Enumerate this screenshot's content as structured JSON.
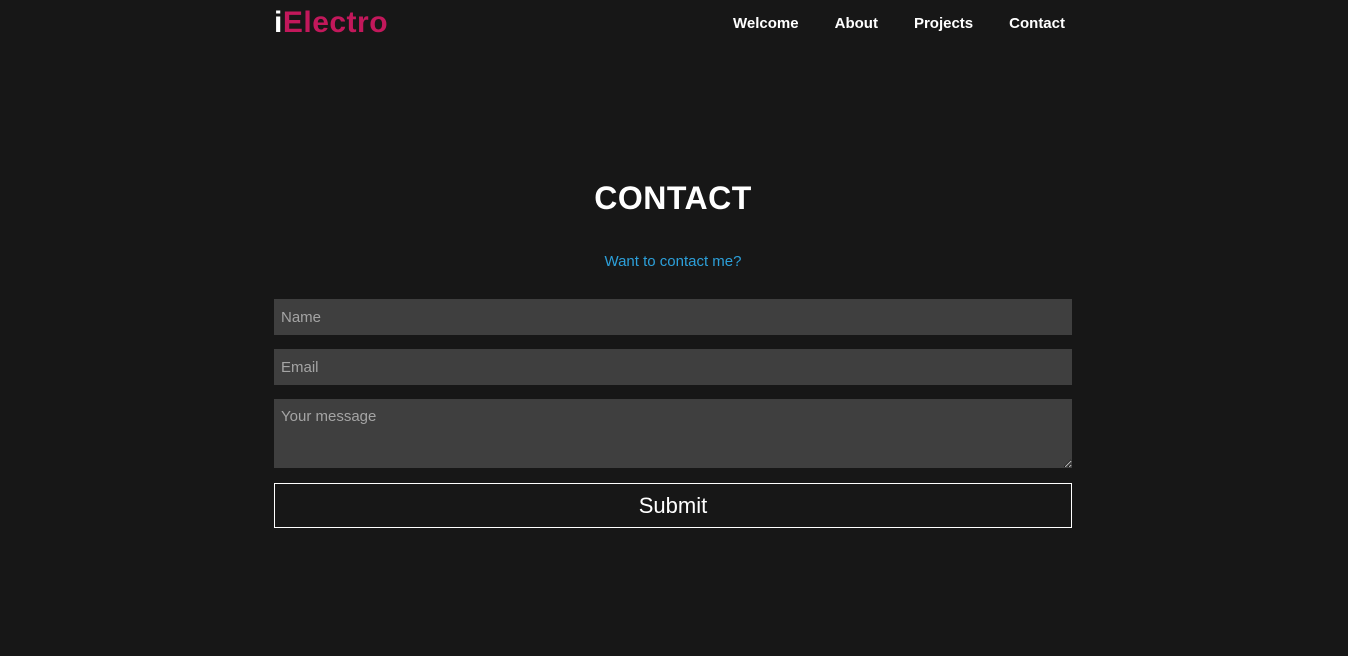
{
  "logo": {
    "prefix": "i",
    "name": "Electro"
  },
  "nav": {
    "items": [
      {
        "label": "Welcome"
      },
      {
        "label": "About"
      },
      {
        "label": "Projects"
      },
      {
        "label": "Contact"
      }
    ]
  },
  "contact": {
    "title": "CONTACT",
    "subtitle": "Want to contact me?",
    "name_placeholder": "Name",
    "email_placeholder": "Email",
    "message_placeholder": "Your message",
    "submit_label": "Submit"
  },
  "colors": {
    "background": "#171717",
    "brand": "#c2185b",
    "link": "#2c9fd9",
    "input_bg": "#3f3f3f"
  }
}
